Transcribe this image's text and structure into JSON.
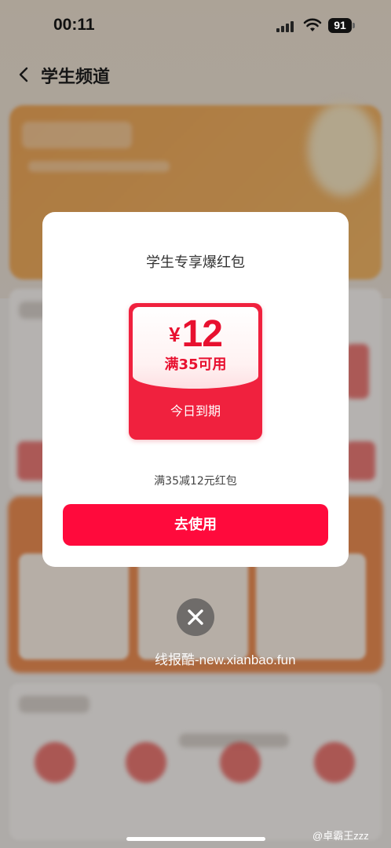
{
  "status_bar": {
    "time": "00:11",
    "battery": "91"
  },
  "nav": {
    "title": "学生频道"
  },
  "modal": {
    "title": "学生专享爆红包",
    "coupon": {
      "currency": "¥",
      "amount": "12",
      "condition": "满35可用",
      "expiry": "今日到期"
    },
    "description": "满35减12元红包",
    "use_button": "去使用"
  },
  "watermark": "线报酷-new.xianbao.fun",
  "weibo_watermark": "@卓霸王zzz",
  "colors": {
    "accent": "#ff0a3c",
    "coupon_red": "#f0213e"
  }
}
